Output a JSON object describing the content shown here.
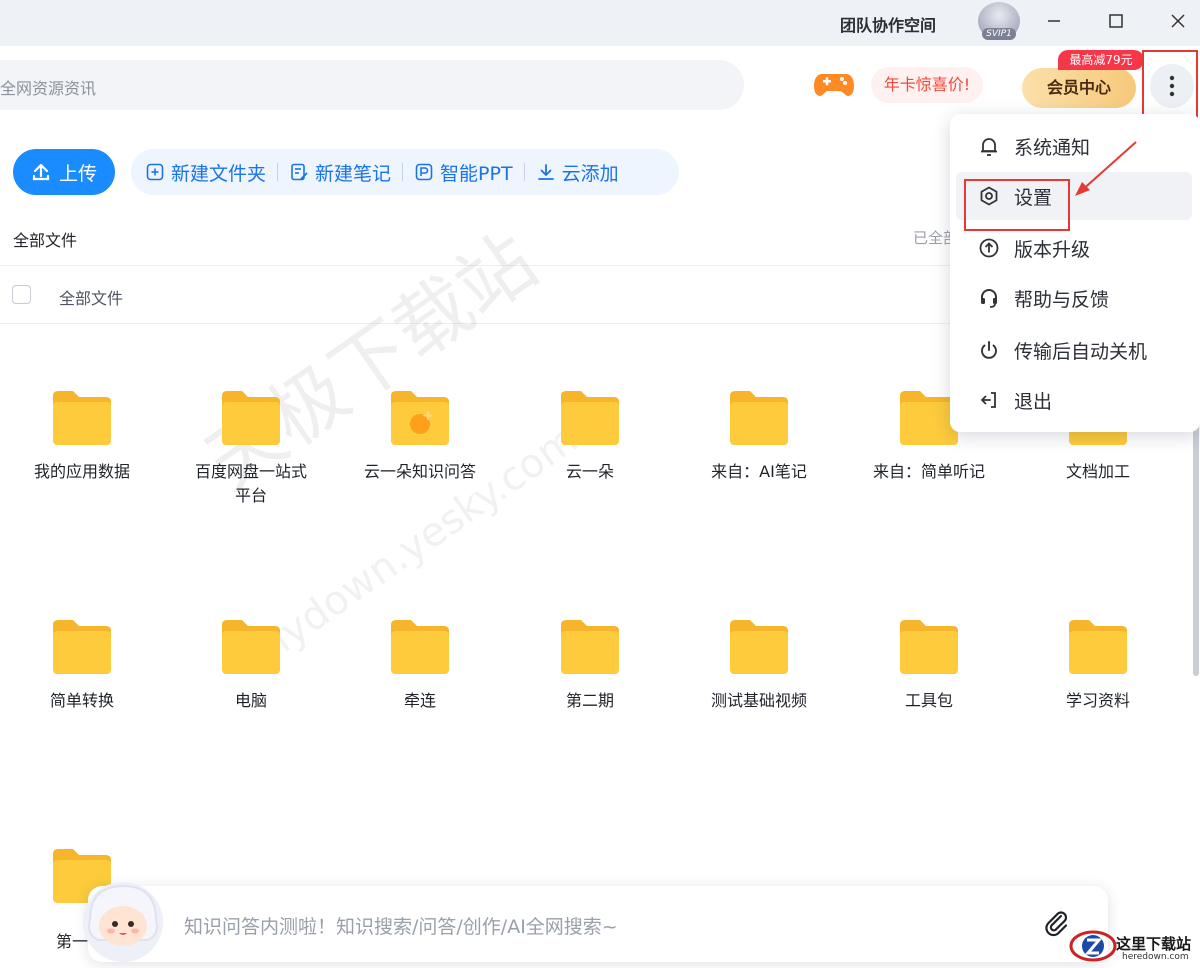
{
  "titlebar": {
    "team_space": "团队协作空间",
    "avatar_badge": "SVIP1"
  },
  "search": {
    "placeholder": "全网资源资讯"
  },
  "header": {
    "promo_label": "年卡惊喜价!",
    "vip_center_label": "会员中心",
    "discount_badge": "最高减79元"
  },
  "toolbar": {
    "upload_label": "上传",
    "actions": [
      {
        "label": "新建文件夹",
        "icon": "add-folder-icon"
      },
      {
        "label": "新建笔记",
        "icon": "note-icon"
      },
      {
        "label": "智能PPT",
        "icon": "ppt-icon"
      },
      {
        "label": "云添加",
        "icon": "download-icon"
      }
    ]
  },
  "breadcrumb": {
    "label": "全部文件",
    "saved_status": "已全部"
  },
  "list_header": {
    "label": "全部文件"
  },
  "folders": [
    {
      "name": "我的应用数据"
    },
    {
      "name": "百度网盘一站式平台"
    },
    {
      "name": "云一朵知识问答"
    },
    {
      "name": "云一朵"
    },
    {
      "name": "来自：AI笔记"
    },
    {
      "name": "来自：简单听记"
    },
    {
      "name": "文档加工"
    },
    {
      "name": "简单转换"
    },
    {
      "name": "电脑"
    },
    {
      "name": "牵连"
    },
    {
      "name": "第二期"
    },
    {
      "name": "测试基础视频"
    },
    {
      "name": "工具包"
    },
    {
      "name": "学习资料"
    },
    {
      "name": "第一"
    }
  ],
  "menu": {
    "items": [
      {
        "label": "系统通知",
        "icon": "bell-icon"
      },
      {
        "label": "设置",
        "icon": "settings-icon"
      },
      {
        "label": "版本升级",
        "icon": "upgrade-icon"
      },
      {
        "label": "帮助与反馈",
        "icon": "headset-icon"
      },
      {
        "label": "传输后自动关机",
        "icon": "power-icon"
      },
      {
        "label": "退出",
        "icon": "logout-icon"
      }
    ]
  },
  "ai_bar": {
    "placeholder": "知识问答内测啦！知识搜索/问答/创作/AI全网搜索~"
  },
  "watermark": {
    "main": "天极下载站",
    "url": "mydown.yesky.com"
  },
  "site_logo": {
    "name": "这里下载站",
    "url": "heredown.com"
  },
  "colors": {
    "accent": "#1a8cff",
    "folder": "#fdc738",
    "highlight": "#e53935"
  }
}
